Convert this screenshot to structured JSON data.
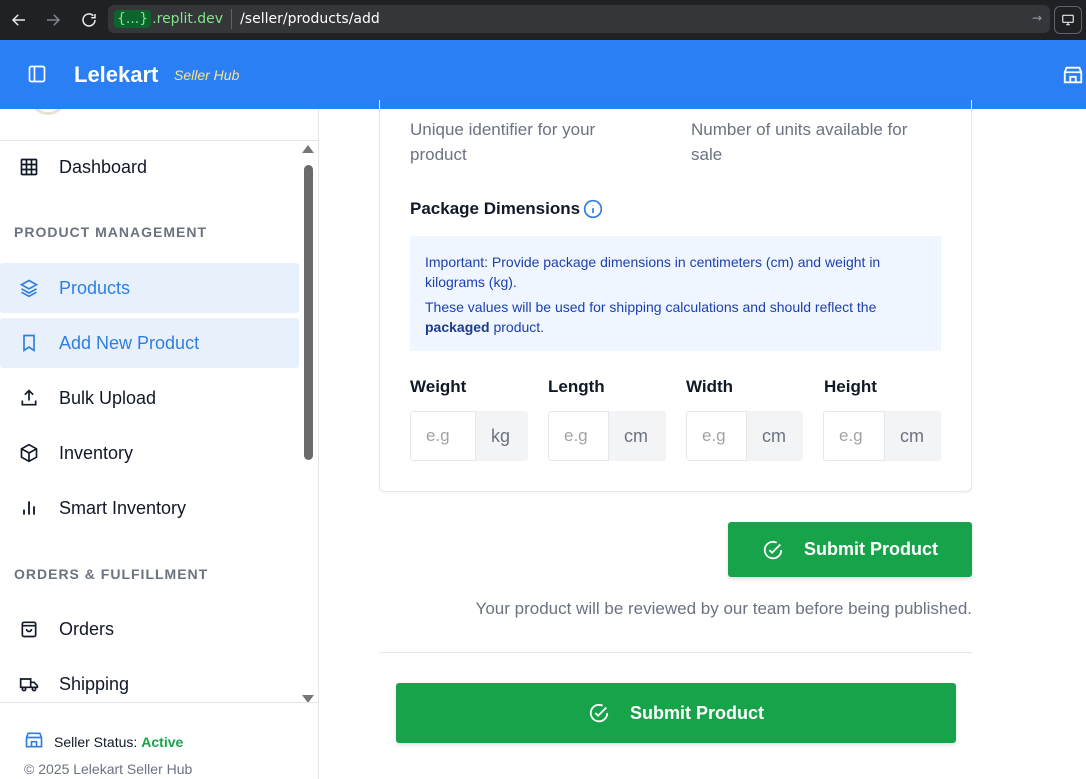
{
  "browser": {
    "host_badge": "{...}",
    "host_domain": ".replit.dev",
    "path": "/seller/products/add"
  },
  "header": {
    "brand": "Lelekart",
    "brand_sub": "Seller Hub"
  },
  "sidebar": {
    "dashboard": "Dashboard",
    "section_product": "PRODUCT MANAGEMENT",
    "products": "Products",
    "add_new_product": "Add New Product",
    "bulk_upload": "Bulk Upload",
    "inventory": "Inventory",
    "smart_inventory": "Smart Inventory",
    "section_orders": "ORDERS & FULFILLMENT",
    "orders": "Orders",
    "shipping": "Shipping",
    "status_label": "Seller Status:",
    "status_value": "Active",
    "copyright": "© 2025 Lelekart Seller Hub"
  },
  "form": {
    "sku_hint_1": "Unique identifier for your",
    "sku_hint_2": "product",
    "stock_hint_1": "Number of units available for",
    "stock_hint_2": "sale",
    "package_title": "Package Dimensions",
    "notice_line1": "Important: Provide package dimensions in centimeters (cm) and weight in kilograms (kg).",
    "notice_line2_pre": "These values will be used for shipping calculations and should reflect the",
    "notice_bold": "packaged",
    "notice_line2_post": "product.",
    "weight_label": "Weight",
    "length_label": "Length",
    "width_label": "Width",
    "height_label": "Height",
    "placeholder": "e.g",
    "unit_kg": "kg",
    "unit_cm": "cm",
    "submit_label": "Submit Product",
    "review_note": "Your product will be reviewed by our team before being published."
  },
  "colors": {
    "header_blue": "#2a7ff5",
    "submit_green": "#16a34a",
    "active_bg": "#e8f0fc",
    "status_green": "#16a34a"
  }
}
